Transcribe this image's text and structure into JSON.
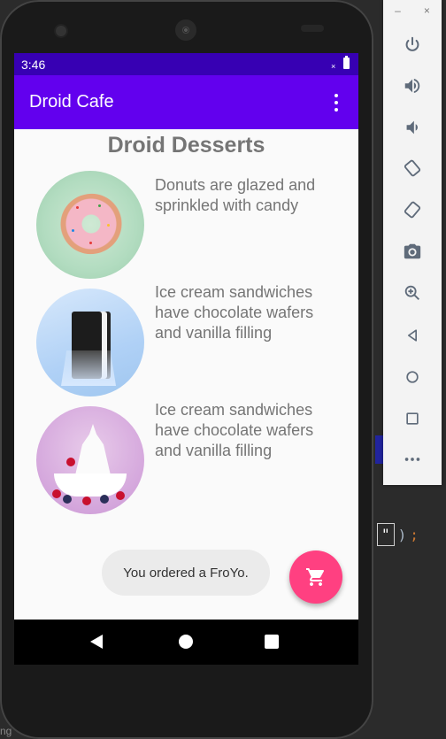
{
  "status_bar": {
    "time": "3:46",
    "indicator": "×"
  },
  "app_bar": {
    "title": "Droid Cafe",
    "overflow_icon": "more-vert-icon"
  },
  "page_title": "Droid Desserts",
  "desserts": [
    {
      "name": "donut",
      "description": "Donuts are glazed and sprinkled with candy"
    },
    {
      "name": "ice-cream-sandwich",
      "description": "Ice cream sandwiches have chocolate wafers and vanilla filling"
    },
    {
      "name": "froyo",
      "description": "Ice cream sandwiches have chocolate wafers and vanilla filling"
    }
  ],
  "toast": {
    "text": "You ordered a FroYo."
  },
  "fab": {
    "icon": "shopping-cart-icon",
    "color": "#ff4081"
  },
  "colors": {
    "status_bar": "#3700b3",
    "app_bar": "#6200ee",
    "background": "#fafafa"
  },
  "emulator_toolbar": {
    "window_controls": [
      "–",
      "×"
    ],
    "buttons": [
      "power-icon",
      "volume-up-icon",
      "volume-down-icon",
      "rotate-left-icon",
      "rotate-right-icon",
      "camera-icon",
      "zoom-icon",
      "back-icon",
      "home-icon",
      "overview-icon",
      "more-icon"
    ]
  },
  "ide": {
    "code_fragment": "\"",
    "code_tail": ")",
    "semicolon": ";",
    "edge_char": "ng"
  }
}
